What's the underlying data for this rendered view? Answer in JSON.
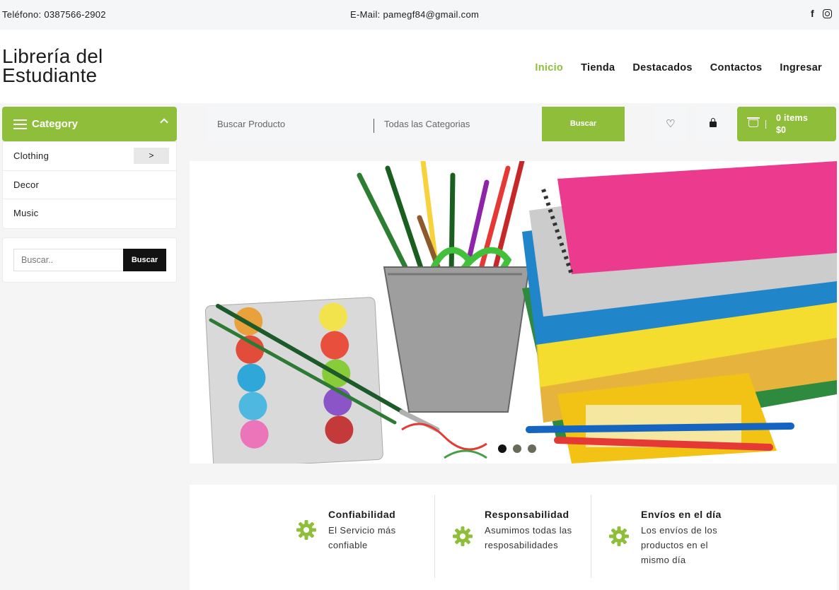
{
  "topbar": {
    "phone": "Teléfono: 0387566-2902",
    "email": "E-Mail: pamegf84@gmail.com",
    "social": [
      "facebook-icon",
      "instagram-icon"
    ]
  },
  "logo": {
    "line1": "Librería del",
    "line2": "Estudiante"
  },
  "nav": {
    "items": [
      {
        "label": "Inicio",
        "active": true
      },
      {
        "label": "Tienda"
      },
      {
        "label": "Destacados"
      },
      {
        "label": "Contactos"
      },
      {
        "label": "Ingresar"
      }
    ]
  },
  "category_menu": {
    "title": "Category",
    "items": [
      {
        "label": "Clothing",
        "has_submenu": true,
        "arrow": ">"
      },
      {
        "label": "Decor"
      },
      {
        "label": "Music"
      }
    ]
  },
  "search": {
    "placeholder": "Buscar Producto",
    "category_select": "Todas las Categorias",
    "button": "Buscar"
  },
  "cart": {
    "items": "0 items",
    "total": "$0"
  },
  "sidebar_search": {
    "placeholder": "Buscar..",
    "button": "Buscar"
  },
  "hero": {
    "slides": 3,
    "active_slide": 1
  },
  "features": [
    {
      "icon": "gear-icon",
      "title": "Confiabilidad",
      "text": "El Servicio más confiable"
    },
    {
      "icon": "gear-icon",
      "title": "Responsabilidad",
      "text": "Asumimos todas las resposabilidades"
    },
    {
      "icon": "gear-icon",
      "title": "Envíos en el día",
      "text": "Los envíos de los productos en el mismo día"
    }
  ],
  "colors": {
    "accent": "#8fbf3a",
    "dark": "#121212",
    "light_bg": "#f5f6f8"
  }
}
